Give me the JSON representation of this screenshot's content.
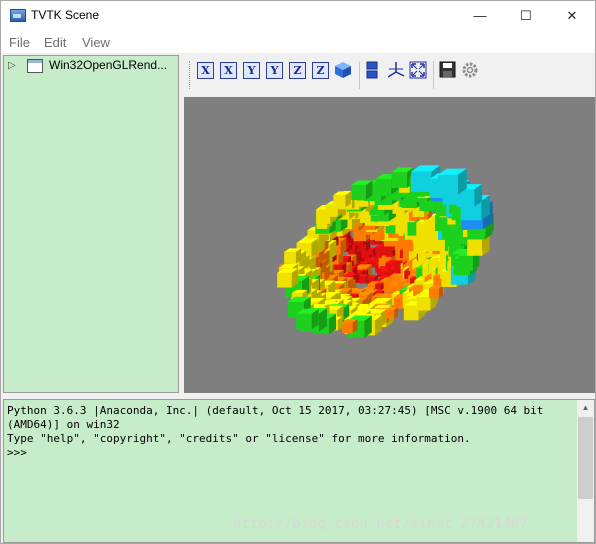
{
  "window": {
    "title": "TVTK Scene",
    "controls": {
      "minimize": "—",
      "maximize": "☐",
      "close": "✕"
    }
  },
  "menubar": {
    "items": [
      "File",
      "Edit",
      "View"
    ]
  },
  "tree": {
    "expand_glyph": "▷",
    "node_label": "Win32OpenGLRend..."
  },
  "toolbar": {
    "buttons": [
      {
        "glyph": "X",
        "icon": "view-minus-x-icon"
      },
      {
        "glyph": "X",
        "icon": "view-plus-x-icon"
      },
      {
        "glyph": "Y",
        "icon": "view-minus-y-icon"
      },
      {
        "glyph": "Y",
        "icon": "view-plus-y-icon"
      },
      {
        "glyph": "Z",
        "icon": "view-minus-z-icon"
      },
      {
        "glyph": "Z",
        "icon": "view-plus-z-icon"
      },
      {
        "glyph": "",
        "icon": "isometric-view-icon"
      },
      {
        "glyph": "",
        "icon": "parallel-projection-icon"
      },
      {
        "glyph": "",
        "icon": "axes-icon"
      },
      {
        "glyph": "",
        "icon": "fullscreen-icon"
      },
      {
        "glyph": "",
        "icon": "save-icon"
      },
      {
        "glyph": "",
        "icon": "configure-icon"
      }
    ]
  },
  "scene": {
    "background": "#7f7f7f",
    "cube_colors": [
      "#e01010",
      "#ff7a00",
      "#f0e000",
      "#1ed01e",
      "#10d0e0",
      "#1e8ef0"
    ]
  },
  "shell": {
    "lines": [
      "Python 3.6.3 |Anaconda, Inc.| (default, Oct 15 2017, 03:27:45) [MSC v.1900 64 bit",
      "(AMD64)] on win32",
      "Type \"help\", \"copyright\", \"credits\" or \"license\" for more information.",
      ">>>"
    ],
    "scroll_up_glyph": "▲",
    "watermark": "http://blog.csdn.net/sinat_27421407"
  }
}
